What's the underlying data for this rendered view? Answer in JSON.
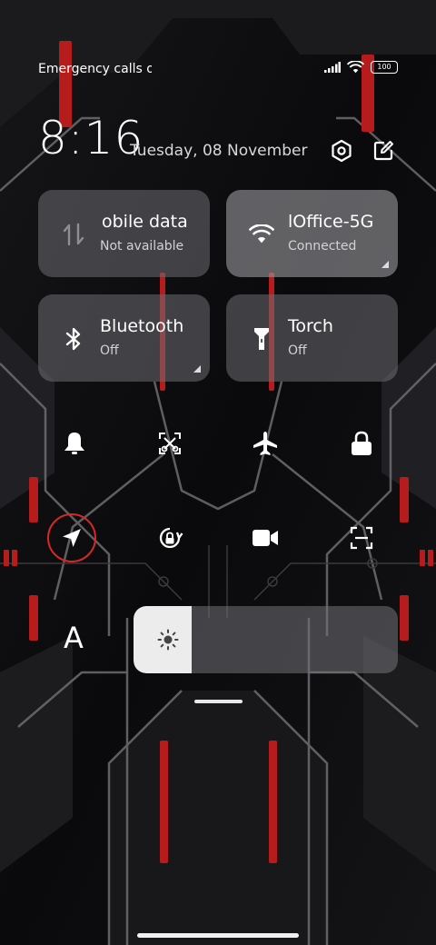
{
  "status_bar": {
    "text": "Emergency calls o",
    "battery": "100",
    "icons": [
      "signal-icon",
      "wifi-icon",
      "battery-icon"
    ]
  },
  "header": {
    "time": "8:16",
    "date": "Tuesday, 08 November",
    "buttons": [
      "settings-icon",
      "edit-icon"
    ]
  },
  "tiles": [
    {
      "name": "mobile-data",
      "title": "obile data",
      "subtitle": "Not available",
      "icon": "mobile-data-icon",
      "active": false
    },
    {
      "name": "wifi",
      "title": "lOffice-5G",
      "subtitle": "Connected",
      "icon": "wifi-icon",
      "active": true
    },
    {
      "name": "bluetooth",
      "title": "Bluetooth",
      "subtitle": "Off",
      "icon": "bluetooth-icon",
      "active": false
    },
    {
      "name": "torch",
      "title": "Torch",
      "subtitle": "Off",
      "icon": "torch-icon",
      "active": false
    }
  ],
  "toggles": [
    "bell-icon",
    "screenshot-icon",
    "airplane-icon",
    "lock-icon",
    "location-icon",
    "rotation-lock-icon",
    "video-icon",
    "scan-icon"
  ],
  "brightness": {
    "level": 0.22,
    "icon": "sun-icon"
  },
  "font_button": {
    "label": "A"
  },
  "colors": {
    "accent_red": "#d62828",
    "tile_bg": "#6e6e73",
    "tile_active_bg": "#96969b",
    "text": "#ffffff"
  }
}
